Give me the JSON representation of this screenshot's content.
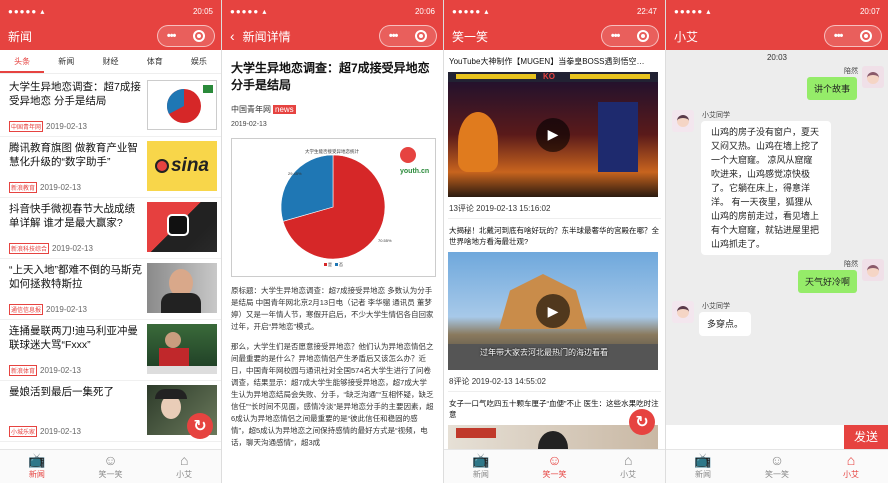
{
  "colors": {
    "brand": "#e64340",
    "chat_right": "#95ec69"
  },
  "phones": [
    {
      "status": {
        "signal": "●●●●● ▴",
        "time": "20:05"
      },
      "nav": {
        "title": "新闻"
      }
    },
    {
      "status": {
        "signal": "●●●●● ▴",
        "time": "20:06"
      },
      "nav": {
        "title": "新闻详情"
      }
    },
    {
      "status": {
        "signal": "●●●●● ▴",
        "time": "22:47"
      },
      "nav": {
        "title": "笑一笑"
      }
    },
    {
      "status": {
        "signal": "●●●●● ▴",
        "time": "20:07"
      },
      "nav": {
        "title": "小艾"
      }
    }
  ],
  "capsule": {
    "dots": "•••"
  },
  "tabs": [
    {
      "label": "新闻",
      "icon": "tv-icon"
    },
    {
      "label": "笑一笑",
      "icon": "smile-icon"
    },
    {
      "label": "小艾",
      "icon": "robot-icon"
    }
  ],
  "news": {
    "categories": [
      "头条",
      "新闻",
      "财经",
      "体育",
      "娱乐"
    ],
    "items": [
      {
        "title": "大学生异地恋调查：超7成接受异地恋 分手是结局",
        "source": "中国青年网",
        "date": "2019-02-13"
      },
      {
        "title": "腾讯教育旗图 做教育产业智慧化升级的“数字助手”",
        "source": "新浪教育",
        "date": "2019-02-13"
      },
      {
        "title": "抖音快手微视春节大战成绩单详解 谁才是最大赢家?",
        "source": "新浪科技综合",
        "date": "2019-02-13"
      },
      {
        "title": "“上天入地”都难不倒的马斯克如何拯救特斯拉",
        "source": "通信信息报",
        "date": "2019-02-13"
      },
      {
        "title": "连捅曼联两刀!迪马利亚冲曼联球迷大骂“Fxxx”",
        "source": "新浪体育",
        "date": "2019-02-13"
      },
      {
        "title": "曼娘活到最后一集死了",
        "source": "小城乐家",
        "date": "2019-02-13"
      }
    ],
    "sina_logo": "sina",
    "fab_icon": "↻"
  },
  "article": {
    "back": "‹",
    "title": "大学生异地恋调查：超7成接受异地恋 分手是结局",
    "source": "中国青年网",
    "tag": "news",
    "date": "2019-02-13",
    "p1": "原标题：大学生异地恋调查：超7成接受异地恋 多数认为分手是结局 中国青年网北京2月13日电（记者 李华骝 通讯员 董梦婷）又是一年情人节，寒假开启后，不少大学生情侣各自回家过年，开启“异地恋”模式。",
    "p2": "那么，大学生们是否愿意接受异地恋？他们认为异地恋情侣之间最重要的是什么？异地恋情侣产生矛盾后又该怎么办？近日，中国青年网校园与通讯社对全国574名大学生进行了问卷调查，结果显示：超7成大学生能够接受异地恋，超7成大学生认为异地恋结局会失败、分手，“缺乏沟通”“互相怀疑，缺乏信任”“长时间不见面，感情冷淡”是异地恋分手的主要因素，超6成认为异地恋情侣之间最重要的是“彼此信任和稳固的感情”，超5成认为异地恋之间保持感情的最好方式是“视频，电话，聊天沟通感情”，超3成",
    "chart_data": {
      "type": "pie",
      "title": "大学生能否接受异地恋统计",
      "categories": [
        "是",
        "否"
      ],
      "values": [
        70.55,
        29.45
      ],
      "labels": [
        "70.55%",
        "29.45%"
      ],
      "colors": [
        "#d62728",
        "#1f77b4"
      ],
      "legend": "bottom"
    },
    "watermark": "youth.cn"
  },
  "videos": {
    "items": [
      {
        "title": "YouTube大神制作【MUGEN】当拳皇BOSS遇到悟空…",
        "comments": "13评论",
        "time": "2019-02-13 15:16:02"
      },
      {
        "title": "大揭秘！北戴河到底有啥好玩的？东半球最奢华的宫殿在哪？全世界啥地方看海最壮观?",
        "comments": "8评论",
        "time": "2019-02-13 14:55:02",
        "caption": "过年带大家去河北最热门的海边看看"
      },
      {
        "title": "女子一口气吃四五十颗车厘子“血便”不止 医生：这些水果吃时注意"
      }
    ],
    "play_icon": "▶",
    "ko": "KO"
  },
  "chat": {
    "time": "20:03",
    "user_name": "陪然",
    "bot_name": "小艾同学",
    "messages": [
      {
        "side": "right",
        "text": "讲个故事"
      },
      {
        "side": "left",
        "text": "山鸡的房子没有窗户，夏天又闷又热。山鸡在墙上挖了一个大窟窿。 凉风从窟窿吹进来，山鸡感觉凉快极了。它躺在床上，得意洋洋。 有一天夜里，狐狸从山鸡的房前走过，看见墙上有个大窟窿，就钻进屋里把山鸡抓走了。"
      },
      {
        "side": "right",
        "text": "天气好冷啊"
      },
      {
        "side": "left",
        "text": "多穿点。"
      }
    ],
    "send_label": "发送"
  }
}
